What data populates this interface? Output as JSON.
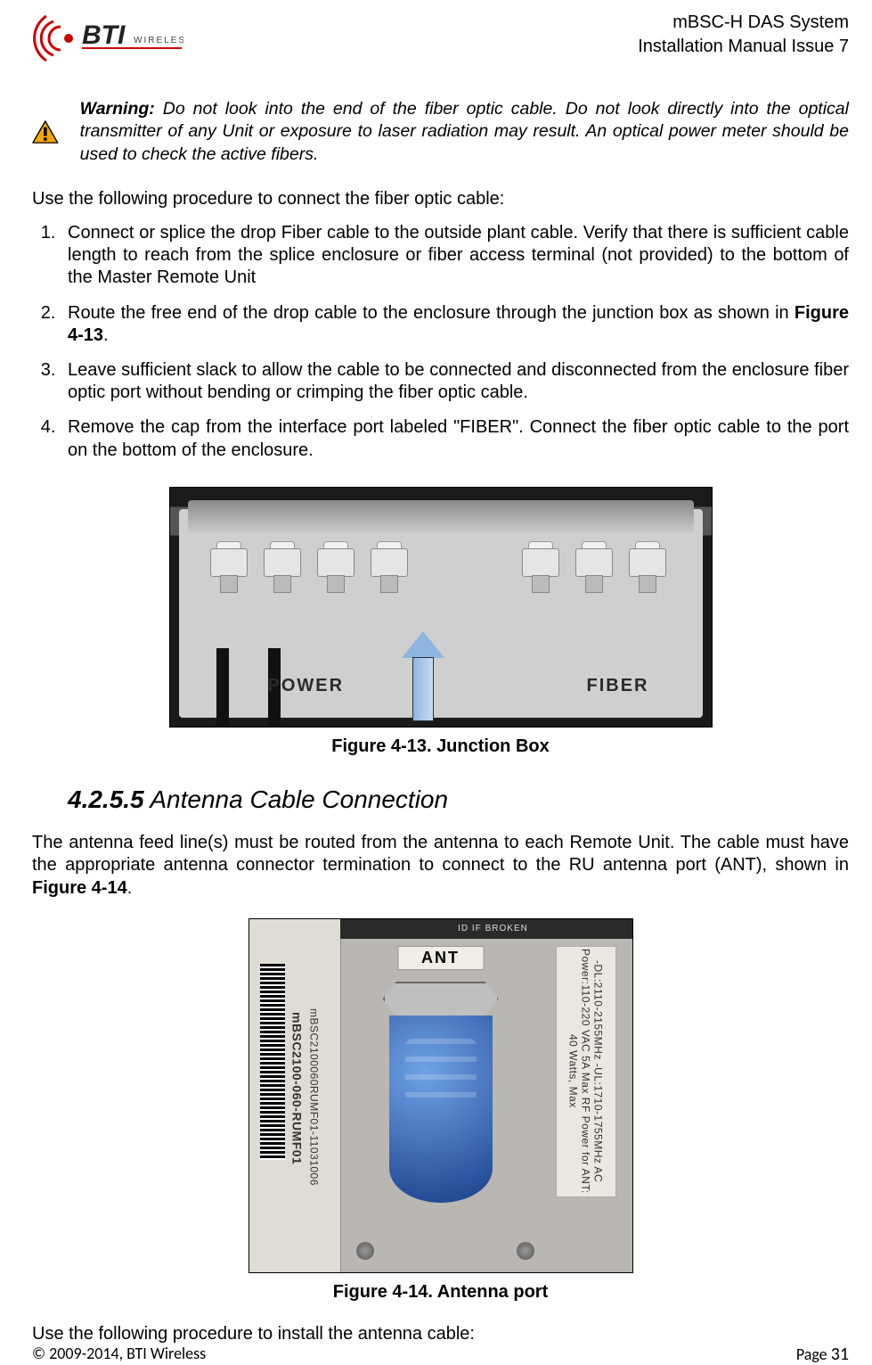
{
  "header": {
    "line1": "mBSC-H DAS System",
    "line2": "Installation Manual Issue 7"
  },
  "logo": {
    "brand": "BTI",
    "sub": "WIRELESS"
  },
  "warning": {
    "label": "Warning:",
    "text": " Do not look into the end of the fiber optic cable. Do not look directly into the optical transmitter of any Unit or exposure to laser radiation may result. An optical power meter should be used to check the active fibers."
  },
  "intro1": "Use the following procedure to connect the fiber optic cable:",
  "steps": [
    {
      "text": "Connect or splice the drop Fiber cable to the outside plant cable. Verify that there is sufficient cable length to reach from the splice enclosure or fiber access terminal (not provided) to the bottom of the Master Remote Unit"
    },
    {
      "pre": "Route the free end of the drop cable to the enclosure through the junction box as shown in ",
      "bold": "Figure 4-13",
      "post": "."
    },
    {
      "text": "Leave sufficient slack to allow the cable to be connected and disconnected from the enclosure fiber optic port without bending or crimping the fiber optic cable."
    },
    {
      "text": "Remove the cap from the interface port labeled \"FIBER\". Connect the fiber optic cable to the port on the bottom of the enclosure."
    }
  ],
  "fig13": {
    "caption": "Figure 4-13. Junction Box",
    "label_left": "POWER",
    "label_right": "FIBER"
  },
  "section": {
    "num": "4.2.5.5",
    "title": " Antenna Cable Connection"
  },
  "antennaPara": {
    "pre": "The antenna feed line(s) must be routed from the antenna to each Remote Unit. The cable must have the appropriate antenna connector termination to connect to the RU antenna port (ANT), shown in ",
    "bold": "Figure 4-14",
    "post": "."
  },
  "fig14": {
    "caption": "Figure 4-14. Antenna port",
    "ant": "ANT",
    "seal": "ID IF BROKEN",
    "leftline1": "mBSC2100-060-RUMF01",
    "leftline2": "mBSC2100060RUMF01-11031006",
    "rightlabel": "-DL:2110-2155MHz  -UL:1710-1755MHz  AC Power:110-220 VAC 5A Max  RF Power for ANT: 40 Watts, Max"
  },
  "intro2": "Use the following procedure to install the antenna cable:",
  "footer": {
    "left": "© 2009-2014, BTI Wireless",
    "right_label": "Page ",
    "right_num": "31"
  }
}
